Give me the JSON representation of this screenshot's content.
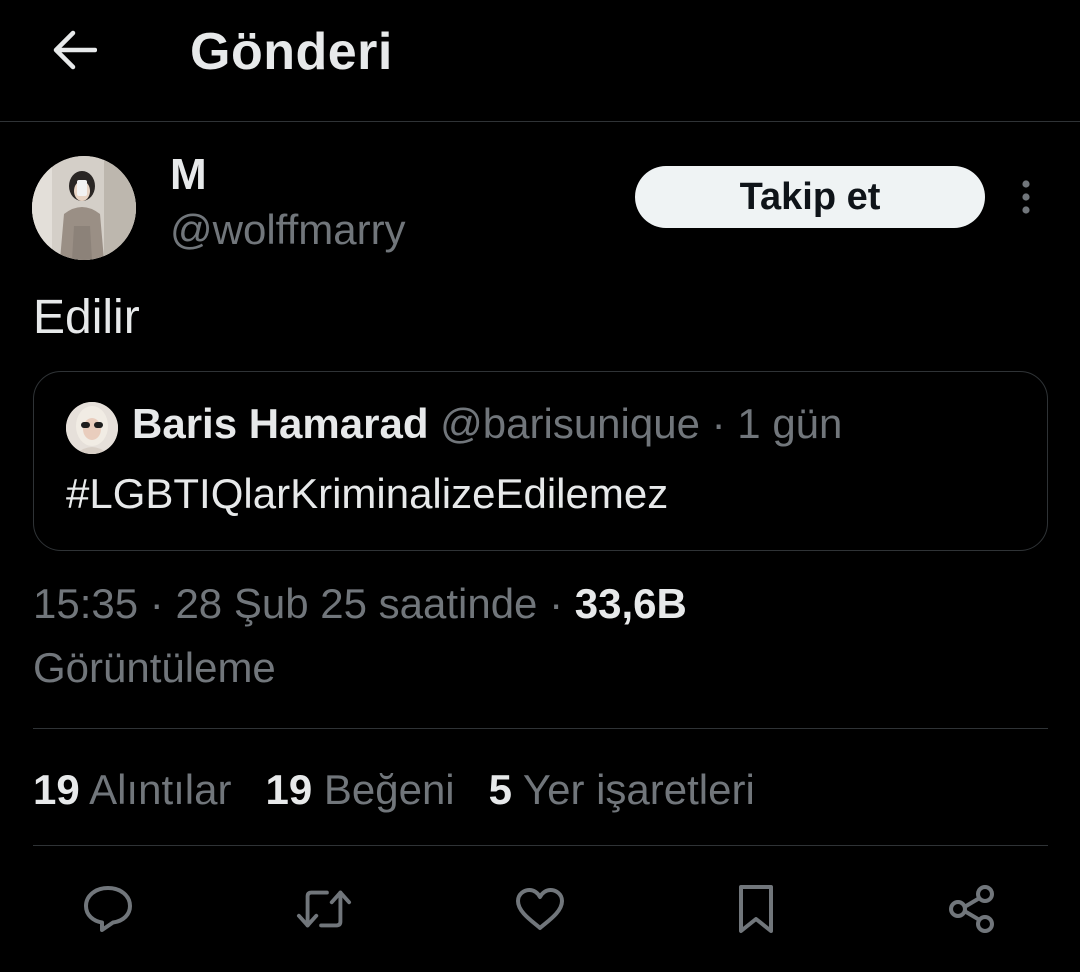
{
  "header": {
    "title": "Gönderi",
    "back_icon": "arrow-left-icon"
  },
  "author": {
    "name": "M",
    "handle": "@wolffmarry",
    "follow_label": "Takip et",
    "more_icon": "more-vertical-icon"
  },
  "tweet": {
    "text": "Edilir"
  },
  "quote": {
    "name": "Baris Hamarad",
    "handle": "@barisunique",
    "separator": "·",
    "time": "1 gün",
    "text": "#LGBTIQlarKriminalizeEdilemez"
  },
  "meta": {
    "time": "15:35",
    "sep1": "·",
    "date": "28 Şub 25 saatinde",
    "sep2": "·",
    "views_count": "33,6B",
    "views_label": "Görüntüleme"
  },
  "stats": [
    {
      "count": "19",
      "label": "Alıntılar"
    },
    {
      "count": "19",
      "label": "Beğeni"
    },
    {
      "count": "5",
      "label": "Yer işaretleri"
    }
  ],
  "actions": [
    "reply-icon",
    "retweet-icon",
    "like-icon",
    "bookmark-icon",
    "share-icon"
  ],
  "colors": {
    "background": "#000000",
    "primary_text": "#e7e9ea",
    "secondary_text": "#71767b",
    "border": "#2f3336",
    "follow_bg": "#eff3f4"
  }
}
